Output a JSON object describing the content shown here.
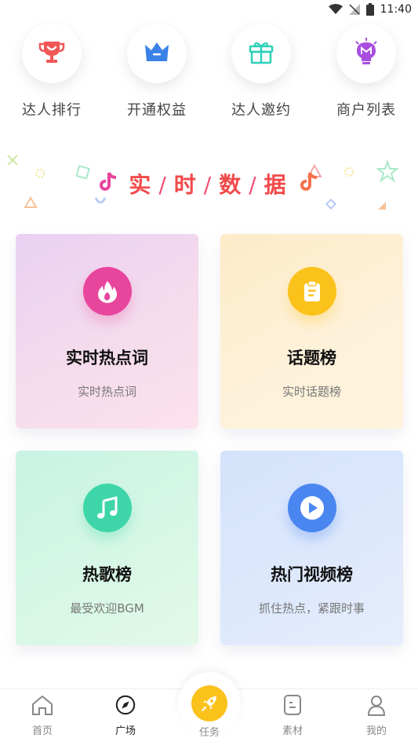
{
  "status_bar": {
    "time": "11:40"
  },
  "quick_entries": [
    {
      "label": "达人排行",
      "icon": "trophy-icon"
    },
    {
      "label": "开通权益",
      "icon": "crown-icon"
    },
    {
      "label": "达人邀约",
      "icon": "gift-icon"
    },
    {
      "label": "商户列表",
      "icon": "lightbulb-icon"
    }
  ],
  "banner": {
    "title_parts": [
      "实",
      "时",
      "数",
      "据"
    ],
    "separator": "/"
  },
  "cards": [
    {
      "title": "实时热点词",
      "subtitle": "实时热点词",
      "icon": "flame-icon",
      "icon_color": "#e8459d"
    },
    {
      "title": "话题榜",
      "subtitle": "实时话题榜",
      "icon": "clipboard-icon",
      "icon_color": "#fbc21c"
    },
    {
      "title": "热歌榜",
      "subtitle": "最受欢迎BGM",
      "icon": "music-note-icon",
      "icon_color": "#3ed6a8"
    },
    {
      "title": "热门视频榜",
      "subtitle": "抓住热点，紧跟时事",
      "icon": "play-icon",
      "icon_color": "#4a86f0"
    }
  ],
  "bottom_nav": {
    "home": "首页",
    "square": "广场",
    "task": "任务",
    "material": "素材",
    "mine": "我的",
    "active": "square"
  },
  "colors": {
    "accent_red": "#f24a4a",
    "task_yellow": "#fbc21c"
  }
}
